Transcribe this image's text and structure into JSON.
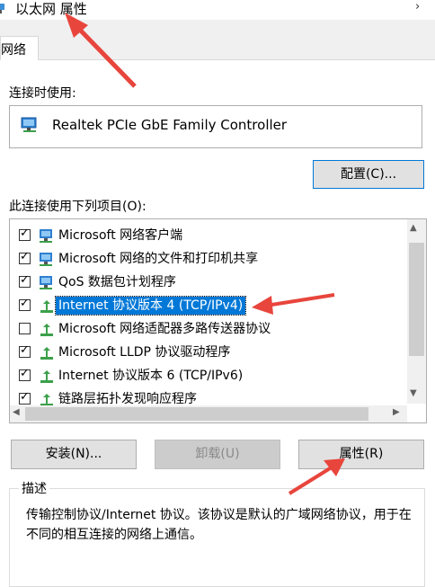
{
  "window": {
    "title": "以太网 属性",
    "close_glyph": "›"
  },
  "tabs": [
    {
      "label": "网络"
    }
  ],
  "connect_using": {
    "label": "连接时使用:",
    "adapter": "Realtek PCIe GbE Family Controller",
    "configure_button": "配置(C)..."
  },
  "items_section": {
    "label": "此连接使用下列项目(O):",
    "items": [
      {
        "label": "Microsoft 网络客户端",
        "checked": true,
        "icon": "network-client-icon"
      },
      {
        "label": "Microsoft 网络的文件和打印机共享",
        "checked": true,
        "icon": "file-share-icon"
      },
      {
        "label": "QoS 数据包计划程序",
        "checked": true,
        "icon": "qos-icon"
      },
      {
        "label": "Internet 协议版本 4 (TCP/IPv4)",
        "checked": true,
        "selected": true,
        "icon": "protocol-icon"
      },
      {
        "label": "Microsoft 网络适配器多路传送器协议",
        "checked": false,
        "icon": "protocol-icon"
      },
      {
        "label": "Microsoft LLDP 协议驱动程序",
        "checked": true,
        "icon": "protocol-icon"
      },
      {
        "label": "Internet 协议版本 6 (TCP/IPv6)",
        "checked": true,
        "icon": "protocol-icon"
      },
      {
        "label": "链路层拓扑发现响应程序",
        "checked": true,
        "icon": "protocol-icon"
      }
    ]
  },
  "buttons": {
    "install": "安装(N)...",
    "uninstall": "卸载(U)",
    "properties": "属性(R)"
  },
  "description": {
    "title": "描述",
    "text": "传输控制协议/Internet 协议。该协议是默认的广域网络协议，用于在不同的相互连接的网络上通信。"
  },
  "colors": {
    "selection": "#0078d7",
    "annotation_arrow": "#e8453c"
  }
}
